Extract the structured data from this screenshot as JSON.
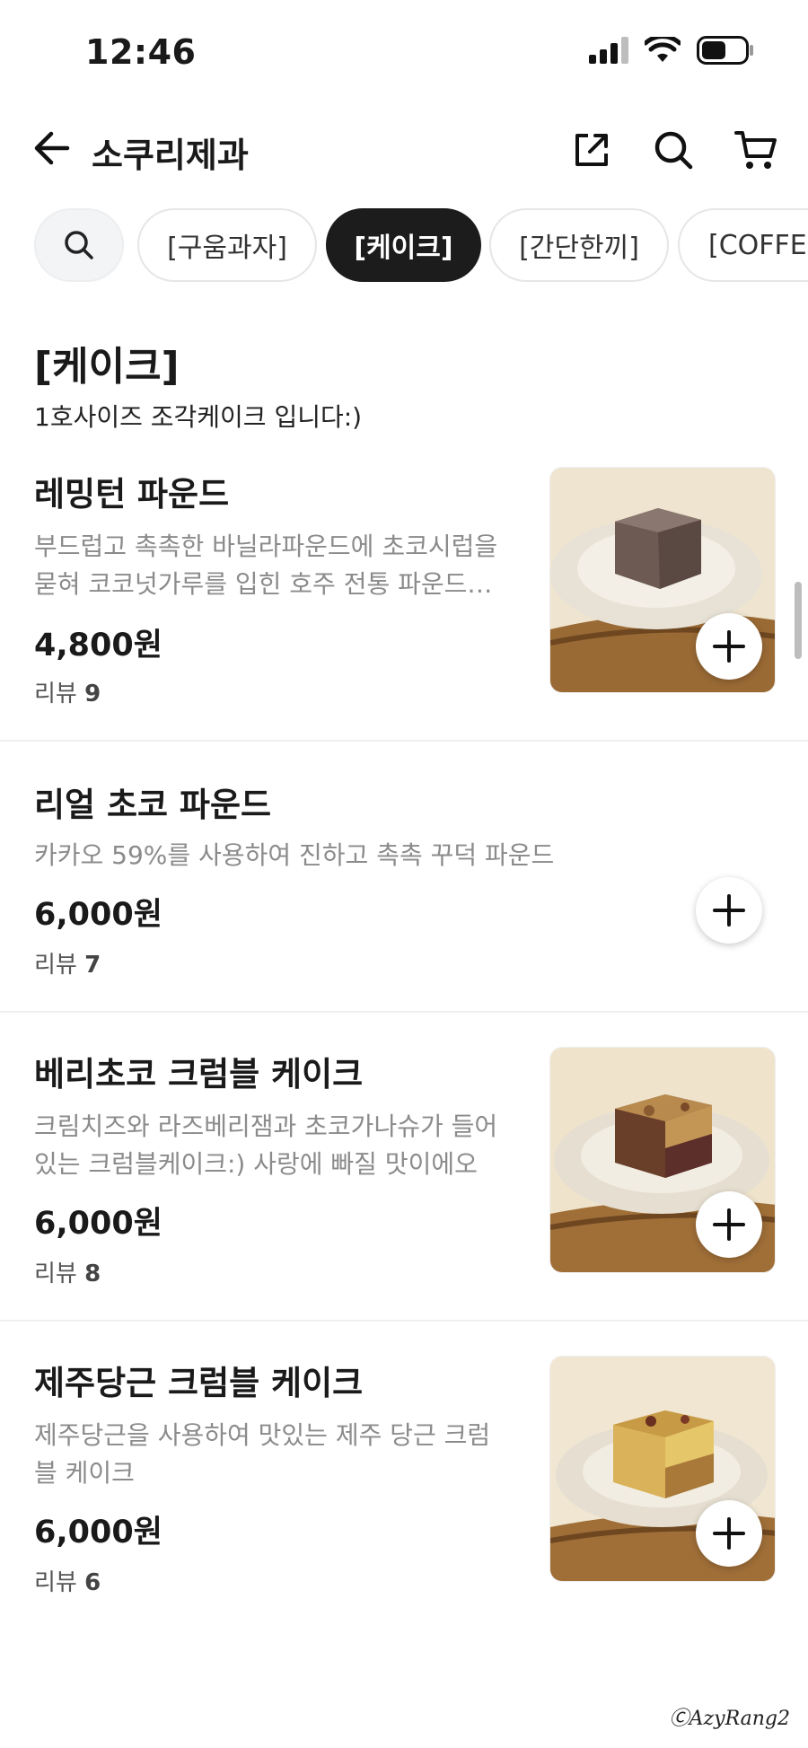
{
  "status": {
    "time": "12:46"
  },
  "header": {
    "title": "소쿠리제과"
  },
  "chips": [
    "[구움과자]",
    "[케이크]",
    "[간단한끼]",
    "[COFFE"
  ],
  "section": {
    "title": "[케이크]",
    "subtitle": "1호사이즈 조각케이크 입니다:)"
  },
  "items": [
    {
      "name": "레밍턴 파운드",
      "desc1": "부드럽고 촉촉한 바닐라파운드에 초코시럽을",
      "desc2": "묻혀 코코넛가루를 입힌 호주 전통 파운드…",
      "price": "4,800원",
      "review_label": "리뷰",
      "review_count": "9"
    },
    {
      "name": "리얼 초코 파운드",
      "desc1": "카카오 59%를 사용하여 진하고 촉촉 꾸덕 파운드",
      "price": "6,000원",
      "review_label": "리뷰",
      "review_count": "7"
    },
    {
      "name": "베리초코 크럼블 케이크",
      "desc1": "크림치즈와 라즈베리잼과 초코가나슈가 들어",
      "desc2": "있는 크럼블케이크:) 사랑에 빠질 맛이에오",
      "price": "6,000원",
      "review_label": "리뷰",
      "review_count": "8"
    },
    {
      "name": "제주당근 크럼블 케이크",
      "desc1": "제주당근을 사용하여 맛있는 제주 당근 크럼",
      "desc2": "블 케이크",
      "price": "6,000원",
      "review_label": "리뷰",
      "review_count": "6"
    }
  ],
  "watermark": "ⒸAzyRang2",
  "colors": {
    "active_chip": "#1c1c1c",
    "desc_text": "#8b8b8b",
    "divider": "#f0f0f0"
  }
}
